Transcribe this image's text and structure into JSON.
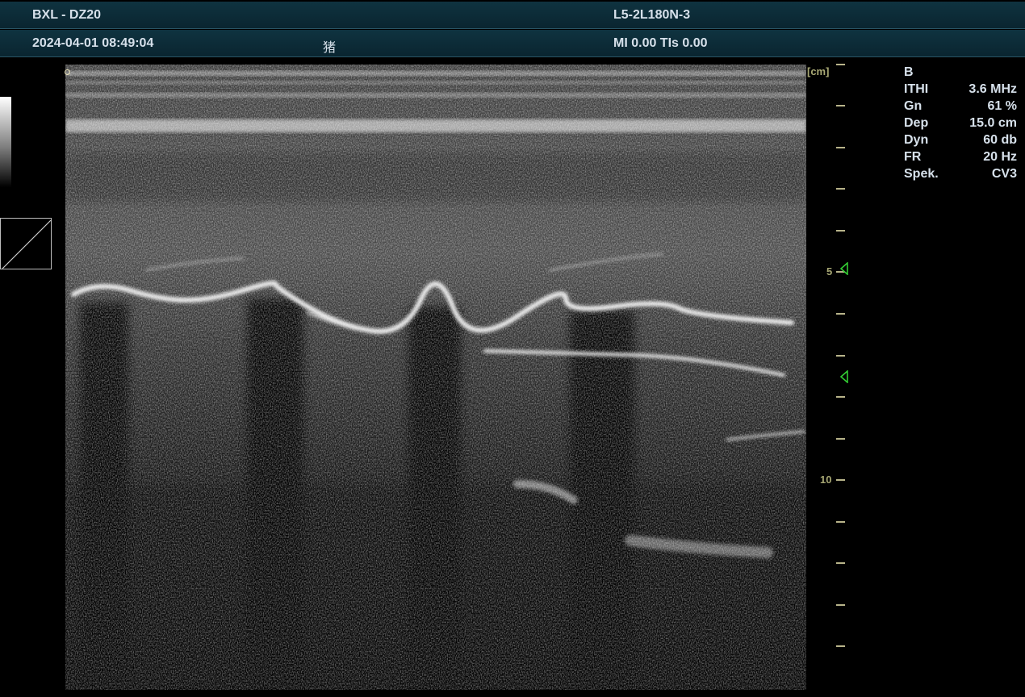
{
  "header": {
    "patient_id": "BXL - DZ20",
    "probe": "L5-2L180N-3",
    "datetime": "2024-04-01 08:49:04",
    "species": "猪",
    "safety_index": "MI 0.00 TIs 0.00"
  },
  "scale": {
    "unit": "[cm]",
    "label_5": "5",
    "label_10": "10"
  },
  "params": {
    "mode": "B",
    "rows": [
      {
        "key": "ITHI",
        "value": "3.6 MHz"
      },
      {
        "key": "Gn",
        "value": "61 %"
      },
      {
        "key": "Dep",
        "value": "15.0 cm"
      },
      {
        "key": "Dyn",
        "value": "60 db"
      },
      {
        "key": "FR",
        "value": "20 Hz"
      },
      {
        "key": "Spek.",
        "value": "CV3"
      }
    ]
  },
  "colors": {
    "header_bg": "#0f3340",
    "scale_color": "#b8b48a",
    "focus_marker": "#33cc33"
  }
}
